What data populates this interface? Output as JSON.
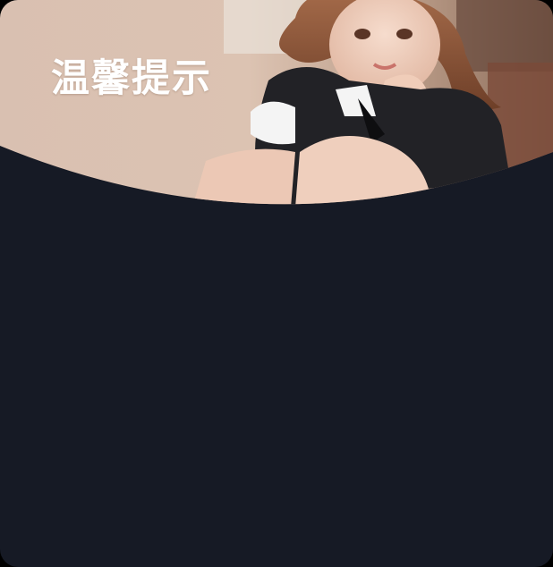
{
  "dialog": {
    "title": "温馨提示",
    "background_color": "#161a25",
    "banner_image": "photo-of-woman-in-maid-outfit"
  }
}
